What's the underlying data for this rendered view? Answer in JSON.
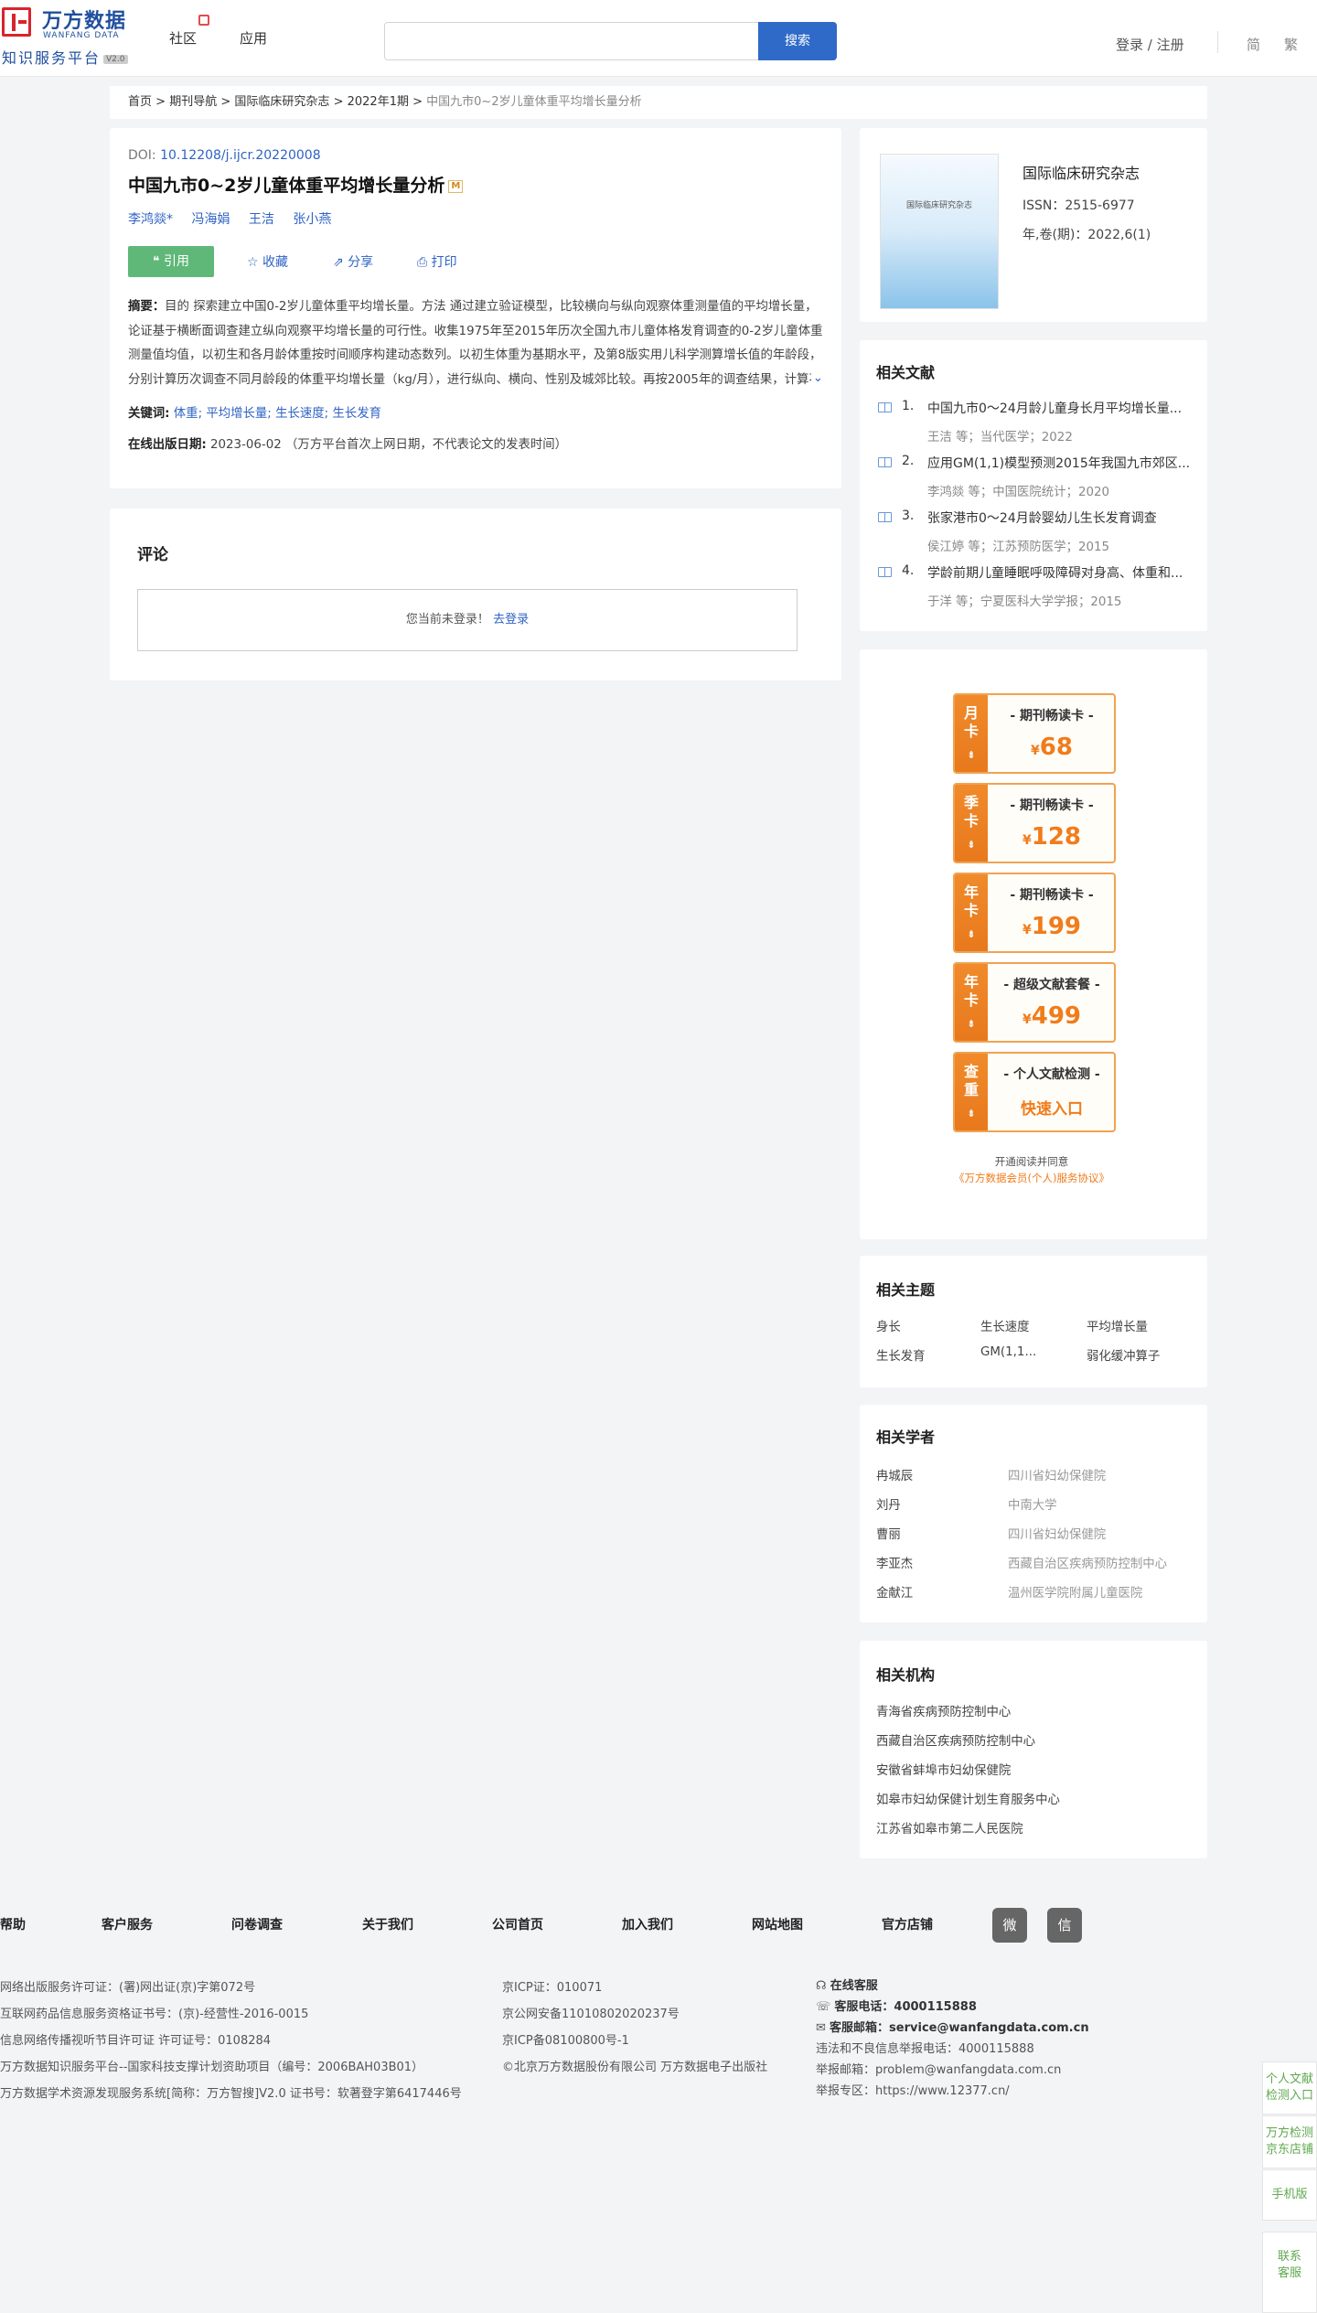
{
  "header": {
    "logo_cn": "万方数据",
    "logo_en": "WANFANG DATA",
    "logo_sub": "知识服务平台",
    "logo_version": "V2.0",
    "nav": [
      "社区",
      "应用"
    ],
    "search_button": "搜索",
    "search_placeholder": "",
    "login": "登录 / 注册",
    "lang_simplified": "简",
    "lang_traditional": "繁"
  },
  "breadcrumb": [
    "首页",
    ">",
    "期刊导航",
    ">",
    "国际临床研究杂志",
    ">",
    "2022年1期",
    ">",
    "中国九市0~2岁儿童体重平均增长量分析"
  ],
  "article": {
    "doi_label": "DOI:",
    "doi": "10.12208/j.ijcr.20220008",
    "title": "中国九市0~2岁儿童体重平均增长量分析",
    "m_badge": "M",
    "authors": [
      "李鸿燚*",
      "冯海娟",
      "王洁",
      "张小燕"
    ],
    "actions": {
      "cite": "引用",
      "favorite": "收藏",
      "share": "分享",
      "print": "打印"
    },
    "abstract_label": "摘要：",
    "abstract": "目的 探索建立中国0-2岁儿童体重平均增长量。方法 通过建立验证模型，比较横向与纵向观察体重测量值的平均增长量，论证基于横断面调查建立纵向观察平均增长量的可行性。收集1975年至2015年历次全国九市儿童体格发育调查的0-2岁儿童体重测量值均值，以初生和各月龄体重按时间顺序构建动态数列。以初生体重为基期水平，及第8版实用儿科学测算增长值的年龄段，分别计算历次调查不同月龄段的体重平均增长量（kg/月），进行纵向、横向、性别及城郊比较。再按2005年的调查结果，计算不同百分位数的体重平均增长量（kg/月）。结果 经验证纵向观察的体重平均增长量与横向观…",
    "keywords_label": "关键词:",
    "keywords": [
      "体重;",
      "平均增长量;",
      "生长速度;",
      "生长发育"
    ],
    "pubdate_label": "在线出版日期:",
    "pubdate": "2023-06-02 （万方平台首次上网日期，不代表论文的发表时间）"
  },
  "comments": {
    "title": "评论",
    "notice": "您当前未登录！",
    "login_link": "去登录"
  },
  "journal": {
    "cover_text": "国际临床研究杂志",
    "name": "国际临床研究杂志",
    "issn": "ISSN：2515-6977",
    "issue": "年,卷(期)：2022,6(1)"
  },
  "related_docs": {
    "title": "相关文献",
    "items": [
      {
        "num": "1.",
        "title": "中国九市0～24月龄儿童身长月平均增长量...",
        "meta": "王洁  等；当代医学；2022"
      },
      {
        "num": "2.",
        "title": "应用GM(1,1)模型预测2015年我国九市郊区...",
        "meta": "李鸿燚  等；中国医院统计；2020"
      },
      {
        "num": "3.",
        "title": "张家港市0～24月龄婴幼儿生长发育调查",
        "meta": "侯江婷  等；江苏预防医学；2015"
      },
      {
        "num": "4.",
        "title": "学龄前期儿童睡眠呼吸障碍对身高、体重和...",
        "meta": "于洋  等；宁夏医科大学学报；2015"
      }
    ]
  },
  "cards": [
    {
      "side": [
        "月",
        "卡"
      ],
      "name": "- 期刊畅读卡 -",
      "currency": "¥",
      "price": "68"
    },
    {
      "side": [
        "季",
        "卡"
      ],
      "name": "- 期刊畅读卡 -",
      "currency": "¥",
      "price": "128"
    },
    {
      "side": [
        "年",
        "卡"
      ],
      "name": "- 期刊畅读卡 -",
      "currency": "¥",
      "price": "199"
    },
    {
      "side": [
        "年",
        "卡"
      ],
      "name": "- 超级文献套餐 -",
      "currency": "¥",
      "price": "499"
    },
    {
      "side": [
        "查",
        "重"
      ],
      "name": "- 个人文献检测 -",
      "link": "快速入口"
    }
  ],
  "card_arrow": "⇟",
  "cards_notice": "开通阅读并同意",
  "cards_agreement": "《万方数据会员(个人)服务协议》",
  "related_topics": {
    "title": "相关主题",
    "items": [
      "身长",
      "生长速度",
      "平均增长量",
      "生长发育",
      "GM(1,1...",
      "弱化缓冲算子"
    ]
  },
  "related_scholars": {
    "title": "相关学者",
    "items": [
      {
        "name": "冉城辰",
        "org": "四川省妇幼保健院"
      },
      {
        "name": "刘丹",
        "org": "中南大学"
      },
      {
        "name": "曹丽",
        "org": "四川省妇幼保健院"
      },
      {
        "name": "李亚杰",
        "org": "西藏自治区疾病预防控制中心"
      },
      {
        "name": "金献江",
        "org": "温州医学院附属儿童医院"
      }
    ]
  },
  "related_orgs": {
    "title": "相关机构",
    "items": [
      "青海省疾病预防控制中心",
      "西藏自治区疾病预防控制中心",
      "安徽省蚌埠市妇幼保健院",
      "如皋市妇幼保健计划生育服务中心",
      "江苏省如皋市第二人民医院"
    ]
  },
  "footer": {
    "nav": [
      "帮助",
      "客户服务",
      "问卷调查",
      "关于我们",
      "公司首页",
      "加入我们",
      "网站地图",
      "官方店铺"
    ],
    "social": [
      "weibo-icon",
      "wechat-icon"
    ],
    "social_glyphs": [
      "微",
      "信"
    ],
    "col1": [
      "网络出版服务许可证：(署)网出证(京)字第072号",
      "互联网药品信息服务资格证书号：(京)-经营性-2016-0015",
      "信息网络传播视听节目许可证 许可证号：0108284",
      "万方数据知识服务平台--国家科技支撑计划资助项目（编号：2006BAH03B01）",
      "万方数据学术资源发现服务系统[简称：万方智搜]V2.0 证书号：软著登字第6417446号"
    ],
    "col2": [
      "京ICP证：010071",
      "京公网安备11010802020237号",
      "京ICP备08100800号-1",
      "©北京万方数据股份有限公司 万方数据电子出版社"
    ],
    "col3_labels": [
      "在线客服",
      "客服电话：",
      "客服邮箱："
    ],
    "phone": "4000115888",
    "email": "service@wanfangdata.com.cn",
    "col3_extra": [
      "违法和不良信息举报电话：4000115888",
      "举报邮箱：problem@wanfangdata.com.cn",
      "举报专区：https://www.12377.cn/"
    ]
  },
  "side_tools": [
    [
      "个人文献",
      "检测入口"
    ],
    [
      "万方检测",
      "京东店铺"
    ],
    [
      "手机版"
    ],
    [
      "联系",
      "客服"
    ]
  ]
}
